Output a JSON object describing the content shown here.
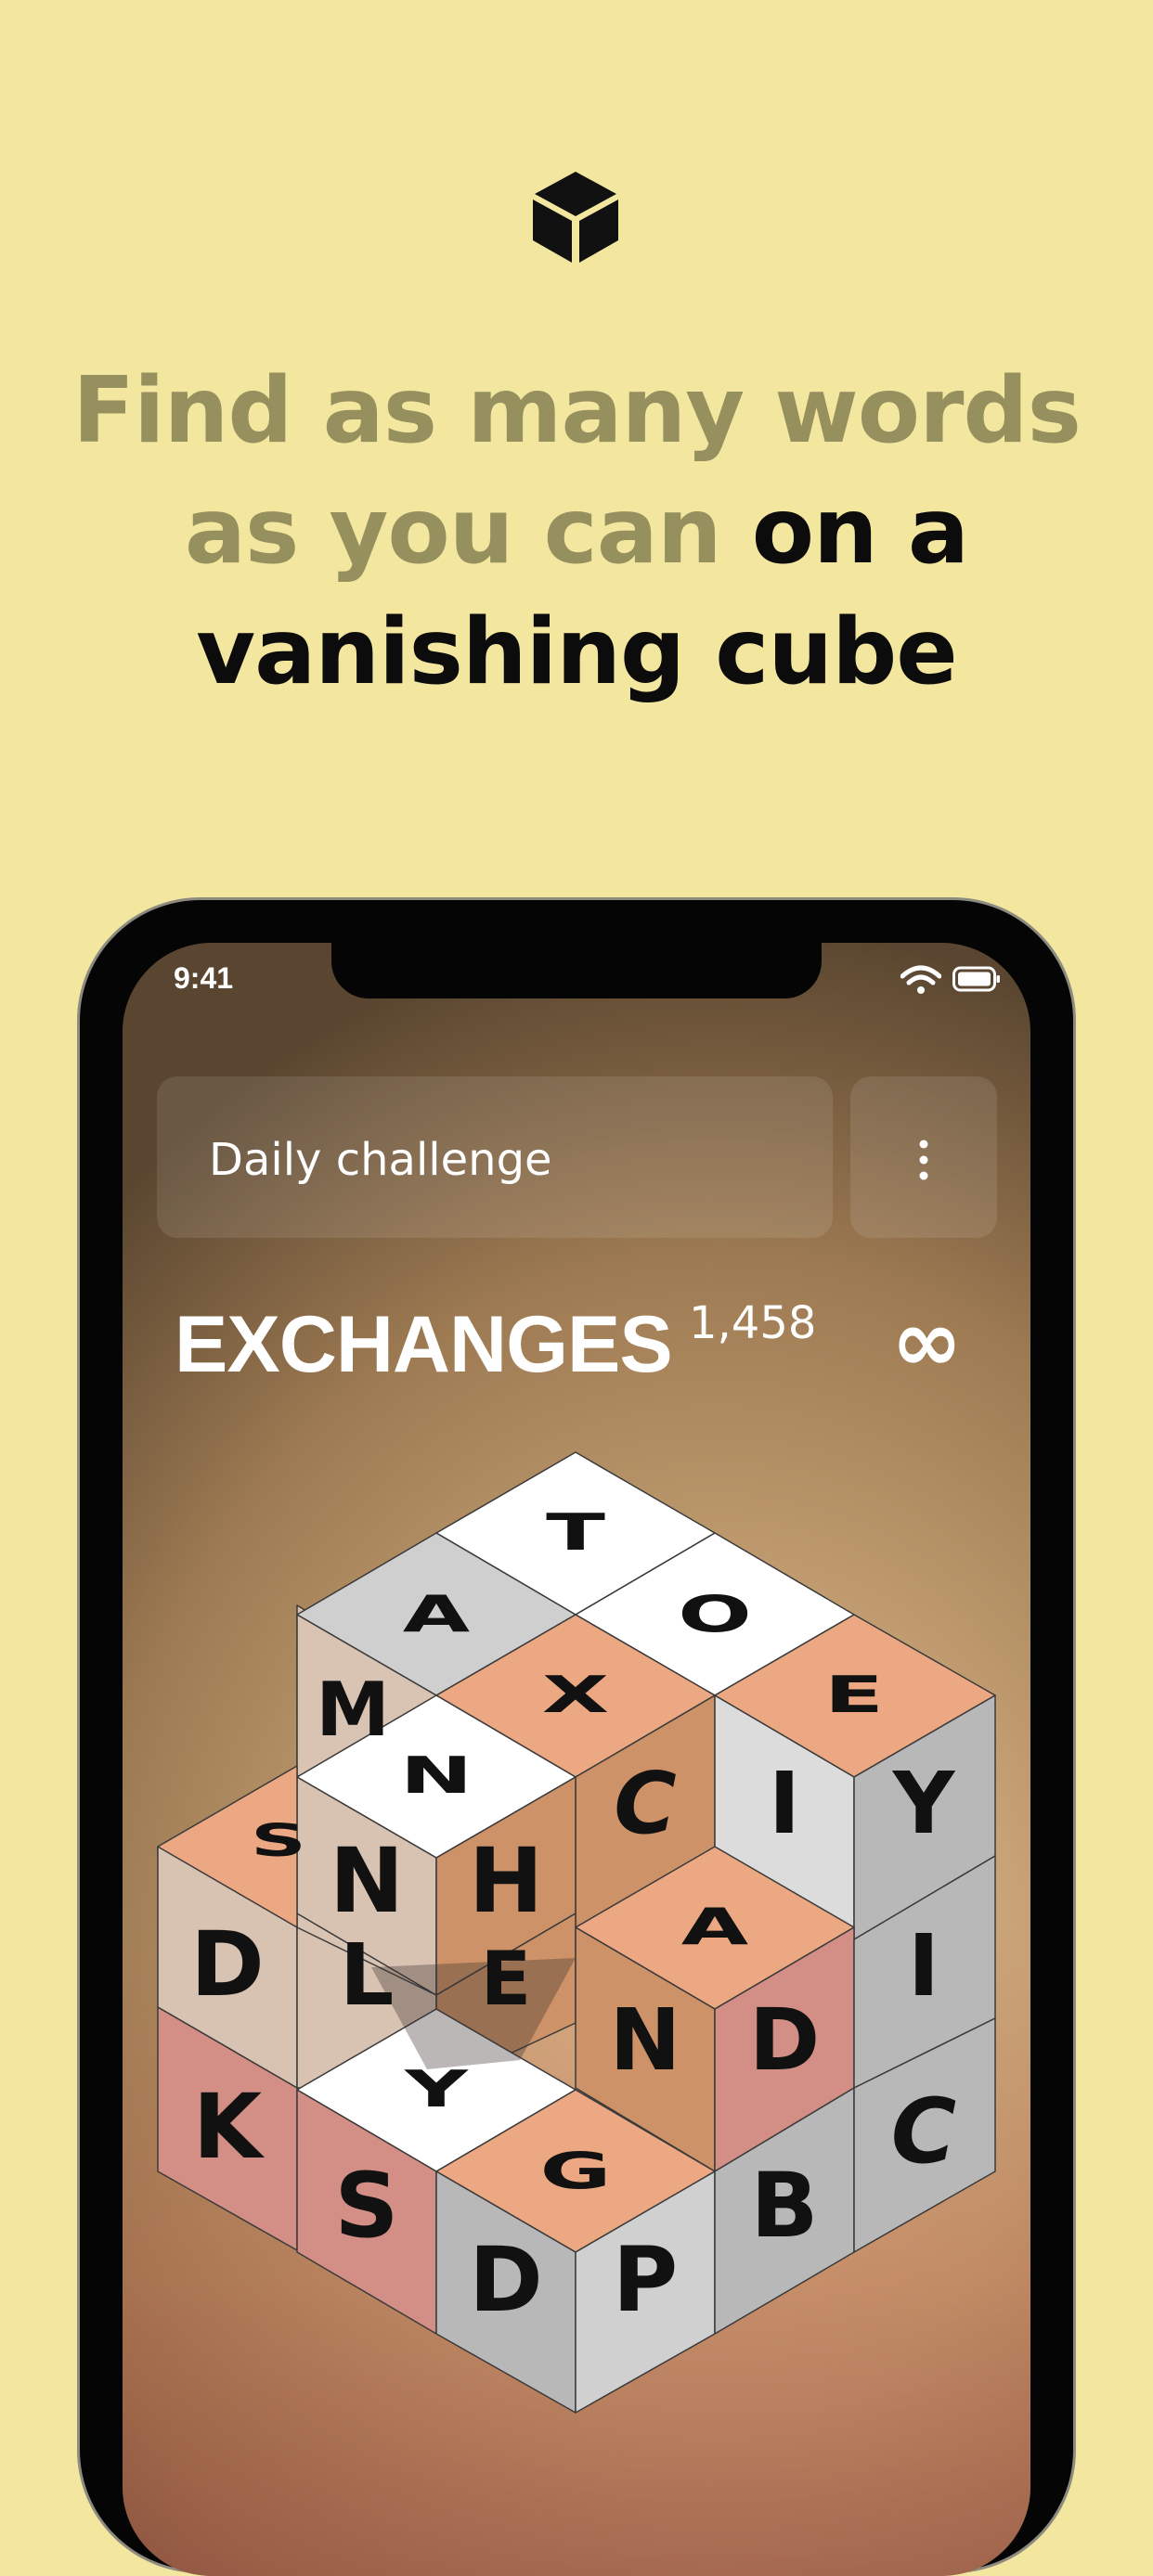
{
  "headline": {
    "line1": "Find as many words",
    "line2_muted": "as you can",
    "line2_strong": "on a",
    "line3": "vanishing cube"
  },
  "status_bar": {
    "time": "9:41"
  },
  "header": {
    "challenge_label": "Daily challenge"
  },
  "game": {
    "title": "EXCHANGES",
    "number": "1,458",
    "moves_symbol": "∞"
  },
  "cube_letters": [
    "T",
    "A",
    "O",
    "X",
    "E",
    "M",
    "N",
    "C",
    "I",
    "Y",
    "S",
    "H",
    "N",
    "D",
    "L",
    "E",
    "A",
    "I",
    "N",
    "D",
    "Y",
    "K",
    "S",
    "G",
    "D",
    "P",
    "B",
    "C"
  ],
  "colors": {
    "background": "#f3e69f",
    "headline_muted": "#96905f",
    "headline_strong": "#0c0c0c",
    "tile_white": "#ffffff",
    "tile_gray": "#cfcfcf",
    "tile_orange": "#eba882",
    "tile_pink": "#d38e86"
  },
  "icons": [
    "cube-logo-icon",
    "wifi-icon",
    "battery-icon",
    "more-vertical-icon"
  ]
}
